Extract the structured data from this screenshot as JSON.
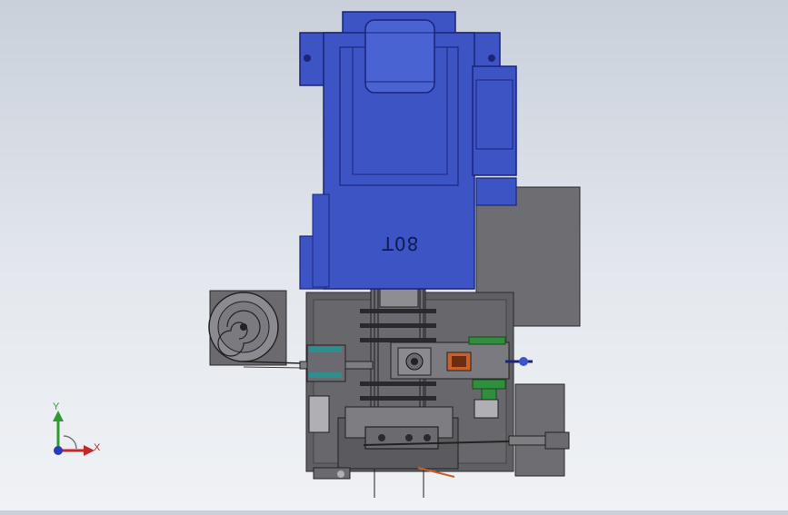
{
  "model_label": "80T",
  "triad": {
    "x_label": "X",
    "y_label": "Y"
  },
  "icons": {
    "triad": "coordinate-triad-icon"
  },
  "colors": {
    "background_top": "#c9d0da",
    "background_bottom": "#f0f2f5",
    "press_body": "#3d55c4",
    "press_edge": "#1a257a",
    "frame": "#5e5e63",
    "plate": "#6f6f74",
    "accent_green": "#2f8f3f",
    "accent_orange": "#c8602a"
  }
}
